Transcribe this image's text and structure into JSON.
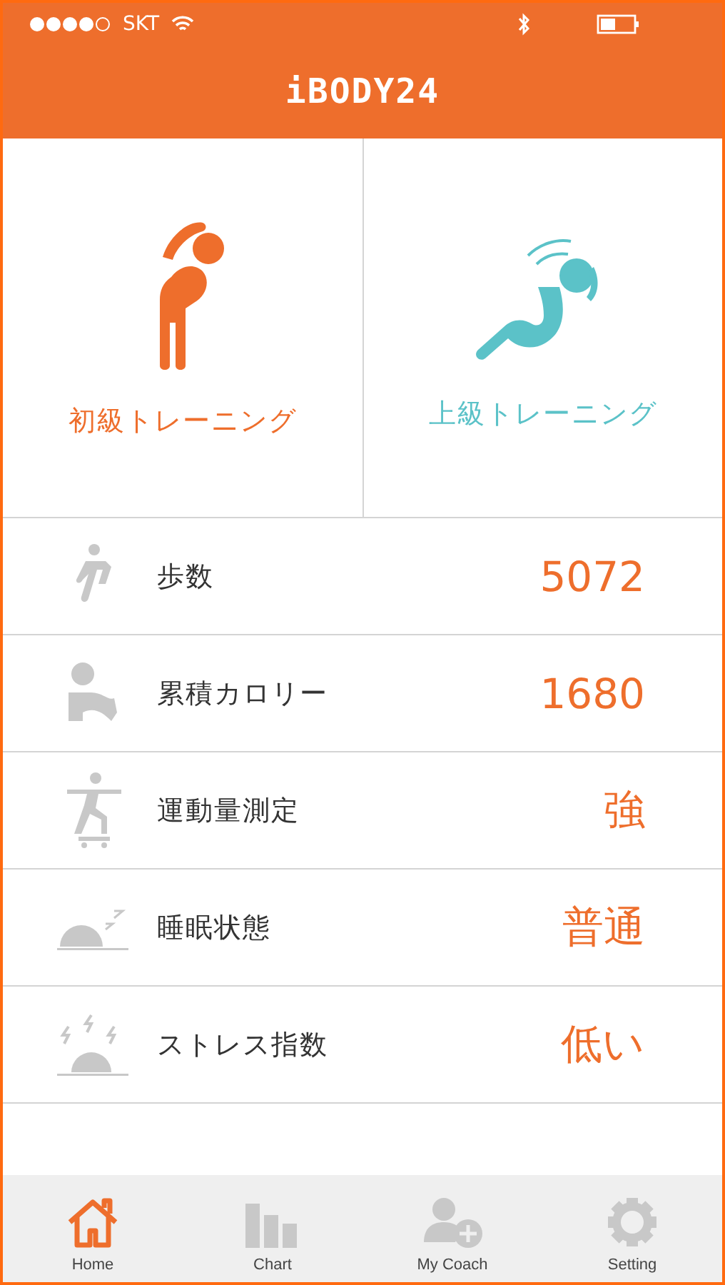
{
  "status_bar": {
    "carrier": "SKT"
  },
  "header": {
    "title": "iBODY24"
  },
  "trainings": [
    {
      "kind": "beginner",
      "label": "初級トレーニング",
      "color": "#ee6e2c"
    },
    {
      "kind": "advanced",
      "label": "上級トレーニング",
      "color": "#5bc2c8"
    }
  ],
  "stats": [
    {
      "kind": "steps",
      "label": "歩数",
      "value": "5072"
    },
    {
      "kind": "calories",
      "label": "累積カロリー",
      "value": "1680"
    },
    {
      "kind": "exercise",
      "label": "運動量測定",
      "value": "強"
    },
    {
      "kind": "sleep",
      "label": "睡眠状態",
      "value": "普通"
    },
    {
      "kind": "stress",
      "label": "ストレス指数",
      "value": "低い"
    }
  ],
  "tab_bar": [
    {
      "kind": "home",
      "label": "Home",
      "selected": true
    },
    {
      "kind": "chart",
      "label": "Chart",
      "selected": false
    },
    {
      "kind": "coach",
      "label": "My Coach",
      "selected": false
    },
    {
      "kind": "setting",
      "label": "Setting",
      "selected": false
    }
  ]
}
